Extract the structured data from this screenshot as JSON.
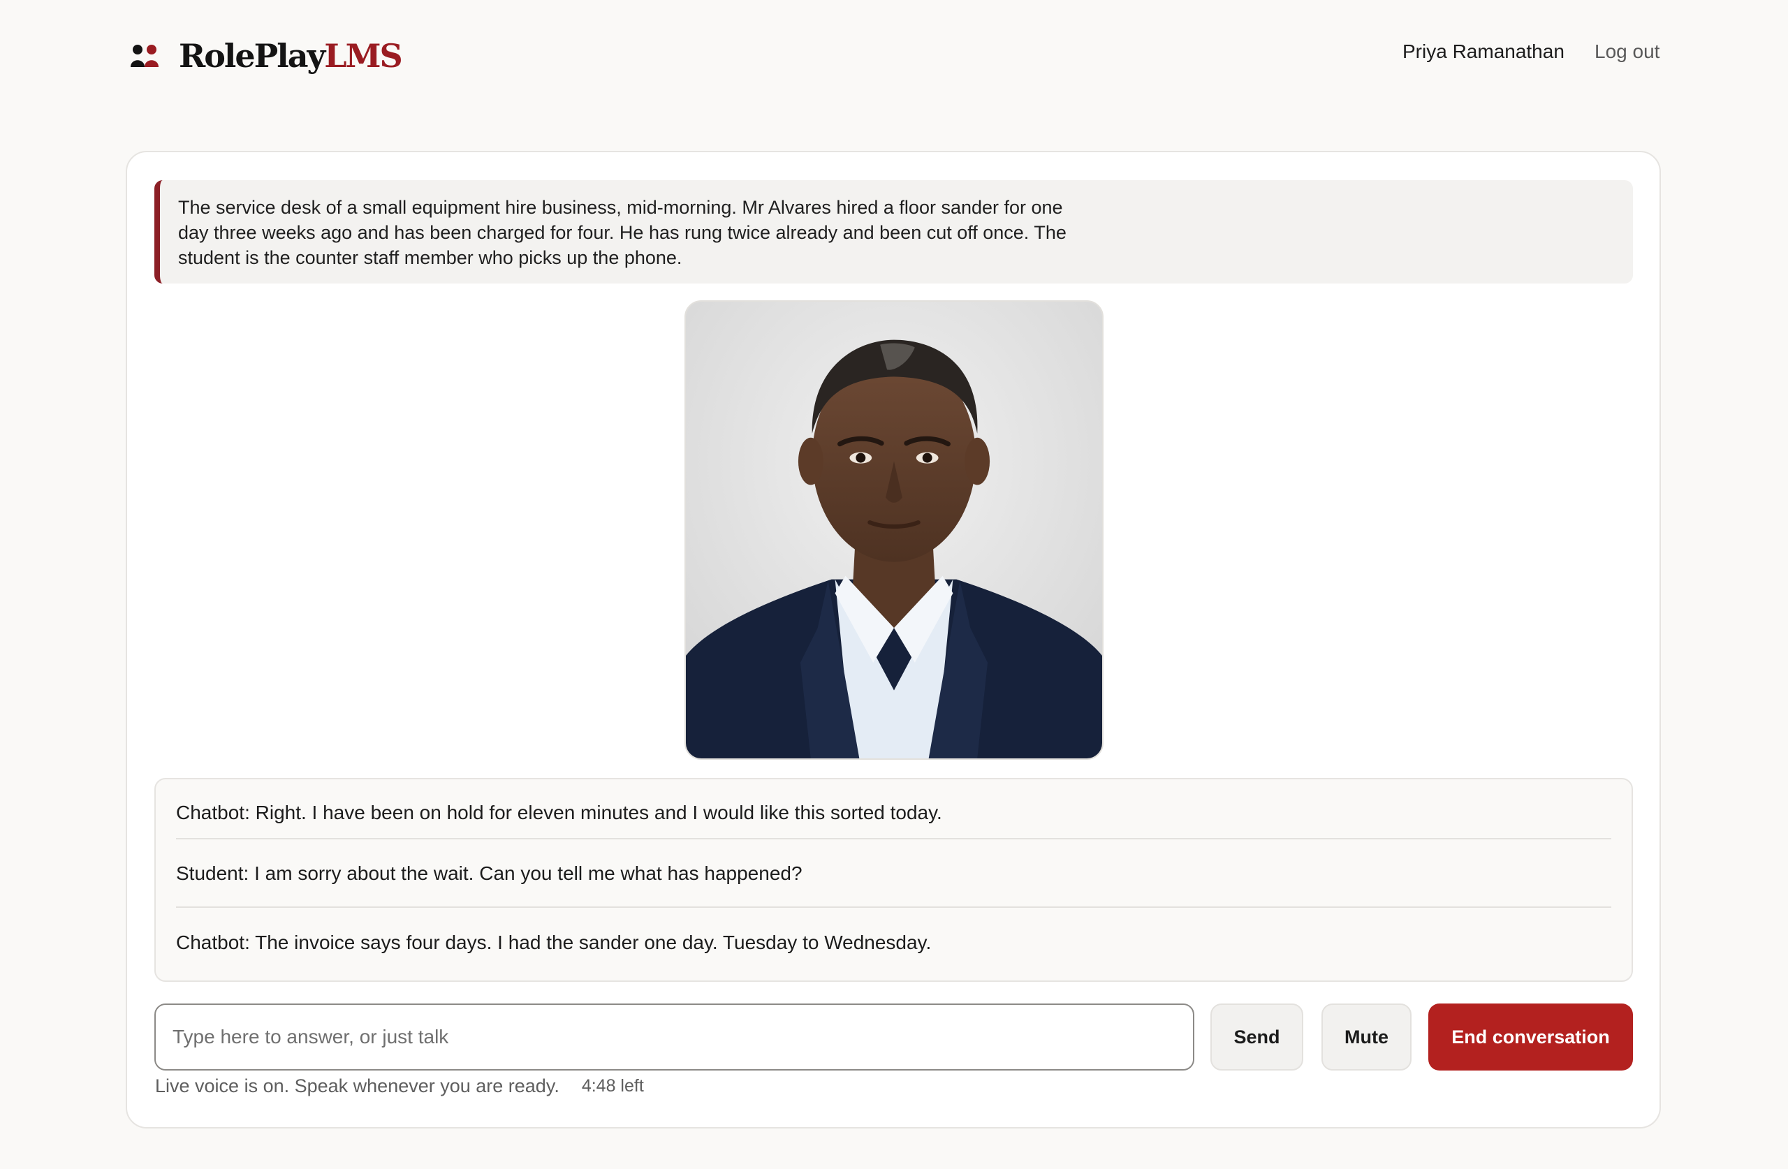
{
  "header": {
    "brand_role": "RolePlay",
    "brand_lms": "LMS",
    "user_name": "Priya Ramanathan",
    "logout_label": "Log out"
  },
  "scenario": {
    "text": "The service desk of a small equipment hire business, mid-morning. Mr Alvares hired a floor sander for one day three weeks ago and has been charged for four. He has rung twice already and been cut off once. The student is the counter staff member who picks up the phone."
  },
  "transcript": [
    {
      "text": "Chatbot: Right. I have been on hold for eleven minutes and I would like this sorted today."
    },
    {
      "text": "Student: I am sorry about the wait. Can you tell me what has happened?"
    },
    {
      "text": "Chatbot: The invoice says four days. I had the sander one day. Tuesday to Wednesday."
    }
  ],
  "composer": {
    "placeholder": "Type here to answer, or just talk",
    "value": "",
    "send_label": "Send",
    "mute_label": "Mute",
    "end_label": "End conversation"
  },
  "status": {
    "voice_text": "Live voice is on. Speak whenever you are ready.",
    "time_left": "4:48 left"
  },
  "colors": {
    "brand_accent": "#9a1c22",
    "end_button": "#b3211f",
    "background": "#faf9f7"
  },
  "icons": {
    "brand": "two-people-icon"
  }
}
